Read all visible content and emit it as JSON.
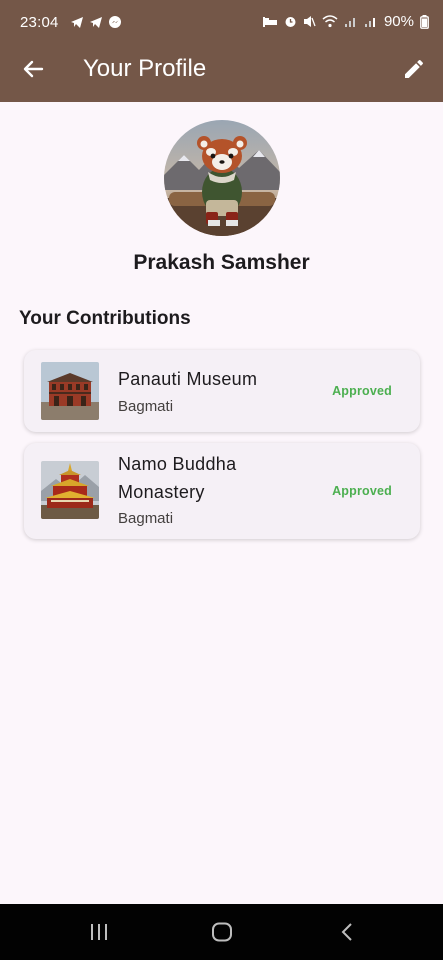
{
  "status_bar": {
    "time": "23:04",
    "battery": "90%",
    "notification_icons": [
      "telegram-icon",
      "telegram-icon",
      "messenger-icon"
    ],
    "system_icons": [
      "sleep-mode-icon",
      "alarm-icon",
      "mute-icon",
      "wifi-icon",
      "signal-icon",
      "signal-icon",
      "battery-icon"
    ]
  },
  "app_bar": {
    "title": "Your Profile",
    "back_icon": "arrow-back-icon",
    "edit_icon": "pencil-icon",
    "background": "#745748"
  },
  "profile": {
    "name": "Prakash Samsher",
    "avatar": "red-panda-avatar"
  },
  "contributions": {
    "heading": "Your Contributions",
    "items": [
      {
        "title": "Panauti Museum",
        "region": "Bagmati",
        "status": "Approved",
        "thumbnail": "museum-building-image"
      },
      {
        "title": "Namo Buddha Monastery",
        "region": "Bagmati",
        "status": "Approved",
        "thumbnail": "monastery-image"
      }
    ],
    "status_color": "#4caf50"
  },
  "nav_bar": {
    "buttons": [
      "recent-apps-icon",
      "home-icon",
      "back-icon"
    ]
  }
}
